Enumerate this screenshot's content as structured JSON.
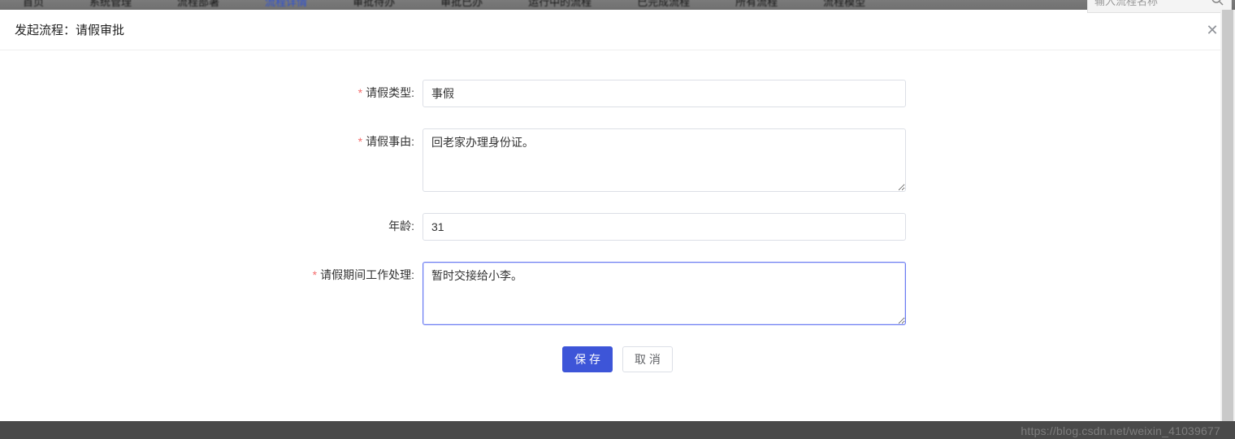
{
  "topbar": {
    "nav_items": [
      "首页",
      "系统管理",
      "流程部署",
      "流程详情",
      "审批待办",
      "审批已办",
      "运行中的流程",
      "已完成流程",
      "所有流程",
      "流程模型"
    ],
    "active_index": 3,
    "search_placeholder": "输入流程名称"
  },
  "modal": {
    "title": "发起流程：请假审批"
  },
  "form": {
    "leave_type": {
      "label": "请假类型:",
      "value": "事假",
      "required": true
    },
    "leave_reason": {
      "label": "请假事由:",
      "value": "回老家办理身份证。",
      "required": true
    },
    "age": {
      "label": "年龄:",
      "value": "31",
      "required": false
    },
    "work_handover": {
      "label": "请假期间工作处理:",
      "value": "暂时交接给小李。",
      "required": true
    }
  },
  "buttons": {
    "save": "保 存",
    "cancel": "取 消"
  },
  "watermark": "https://blog.csdn.net/weixin_41039677"
}
